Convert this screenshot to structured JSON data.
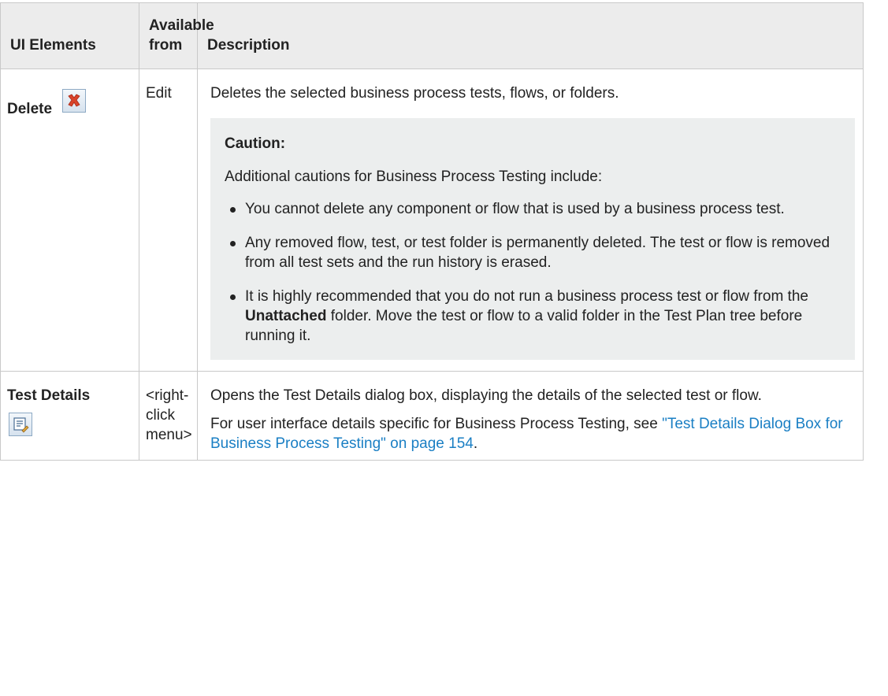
{
  "table": {
    "headers": [
      "UI Elements",
      "Available from",
      "Description"
    ],
    "rows": [
      {
        "element": "Delete",
        "icon": "delete-icon",
        "available_from": "Edit",
        "description": "Deletes the selected business process tests, flows, or folders.",
        "caution_title": "Caution:",
        "caution_intro": "Additional cautions for Business Process Testing include:",
        "caution_items": [
          "You cannot delete any component or flow that is used by a business process test.",
          "Any removed flow, test, or test folder is permanently deleted. The test or flow is removed from all test sets and the run history is erased."
        ],
        "caution_item3": {
          "before": "It is highly recommended that you do not run a business process test or flow from the ",
          "bold": "Unattached",
          "after": " folder. Move the test or flow to a valid folder in the Test Plan tree before running it."
        }
      },
      {
        "element": "Test Details",
        "icon": "test-details-icon",
        "available_from": "<right-click menu>",
        "description": "Opens the Test Details dialog box, displaying the details of the selected test or flow.",
        "description2": "For user interface details specific for Business Process Testing, see ",
        "link_text": "\"Test Details Dialog Box for Business Process Testing\" on page 154",
        "description2_end": "."
      }
    ]
  },
  "colors": {
    "header_bg": "#ececec",
    "caution_bg": "#eceeee",
    "link": "#1a7fc4",
    "delete_x": "#d9442b"
  }
}
